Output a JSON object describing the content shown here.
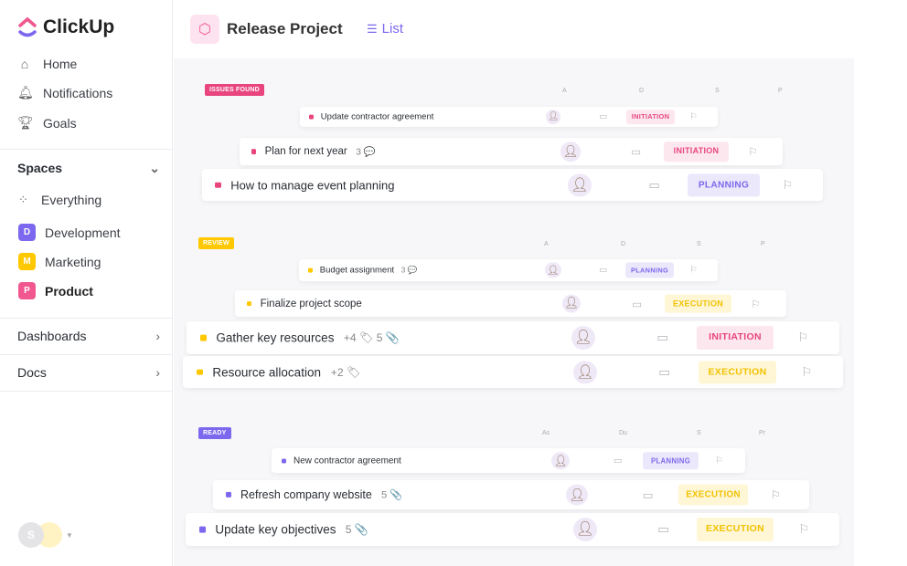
{
  "sidebar": {
    "logo": "ClickUp",
    "nav": [
      {
        "label": "Home",
        "icon": "home-icon"
      },
      {
        "label": "Notifications",
        "icon": "bell-icon"
      },
      {
        "label": "Goals",
        "icon": "trophy-icon"
      }
    ],
    "spaces_label": "Spaces",
    "everything": "Everything",
    "spaces": [
      {
        "letter": "D",
        "label": "Development",
        "color": "#7b68ee"
      },
      {
        "letter": "M",
        "label": "Marketing",
        "color": "#ffc800"
      },
      {
        "letter": "P",
        "label": "Product",
        "color": "#f0588f"
      }
    ],
    "dashboards": "Dashboards",
    "docs": "Docs",
    "user_initial": "S"
  },
  "header": {
    "title": "Release Project",
    "view_tab": "List"
  },
  "status_colors": {
    "INITIATION": {
      "bg": "#fde7ef",
      "fg": "#e8457f"
    },
    "PLANNING": {
      "bg": "#ece8fb",
      "fg": "#7b68ee"
    },
    "EXECUTION": {
      "bg": "#fff6d6",
      "fg": "#f2c200"
    }
  },
  "groups": [
    {
      "label": "ISSUES FOUND",
      "color": "#e8457f",
      "columns": [
        "A",
        "D",
        "S",
        "P"
      ],
      "tasks": [
        {
          "name": "Update contractor agreement",
          "meta": "",
          "status": "INITIATION"
        },
        {
          "name": "Plan for next year",
          "meta": "3 💬",
          "status": "INITIATION"
        },
        {
          "name": "How to manage event planning",
          "meta": "",
          "status": "PLANNING"
        }
      ]
    },
    {
      "label": "REVIEW",
      "color": "#ffc800",
      "columns": [
        "A",
        "D",
        "S",
        "P"
      ],
      "tasks": [
        {
          "name": "Budget assignment",
          "meta": "3 💬",
          "status": "PLANNING"
        },
        {
          "name": "Finalize project scope",
          "meta": "",
          "status": "EXECUTION"
        },
        {
          "name": "Gather key resources",
          "meta": "+4 🏷   5 📎",
          "status": "INITIATION"
        },
        {
          "name": "Resource allocation",
          "meta": "+2 🏷",
          "status": "EXECUTION"
        }
      ]
    },
    {
      "label": "READY",
      "color": "#7b68ee",
      "columns": [
        "As",
        "Du",
        "S",
        "Pr"
      ],
      "tasks": [
        {
          "name": "New contractor agreement",
          "meta": "",
          "status": "PLANNING"
        },
        {
          "name": "Refresh company website",
          "meta": "5 📎",
          "status": "EXECUTION"
        },
        {
          "name": "Update key objectives",
          "meta": "5 📎",
          "status": "EXECUTION"
        }
      ]
    }
  ]
}
